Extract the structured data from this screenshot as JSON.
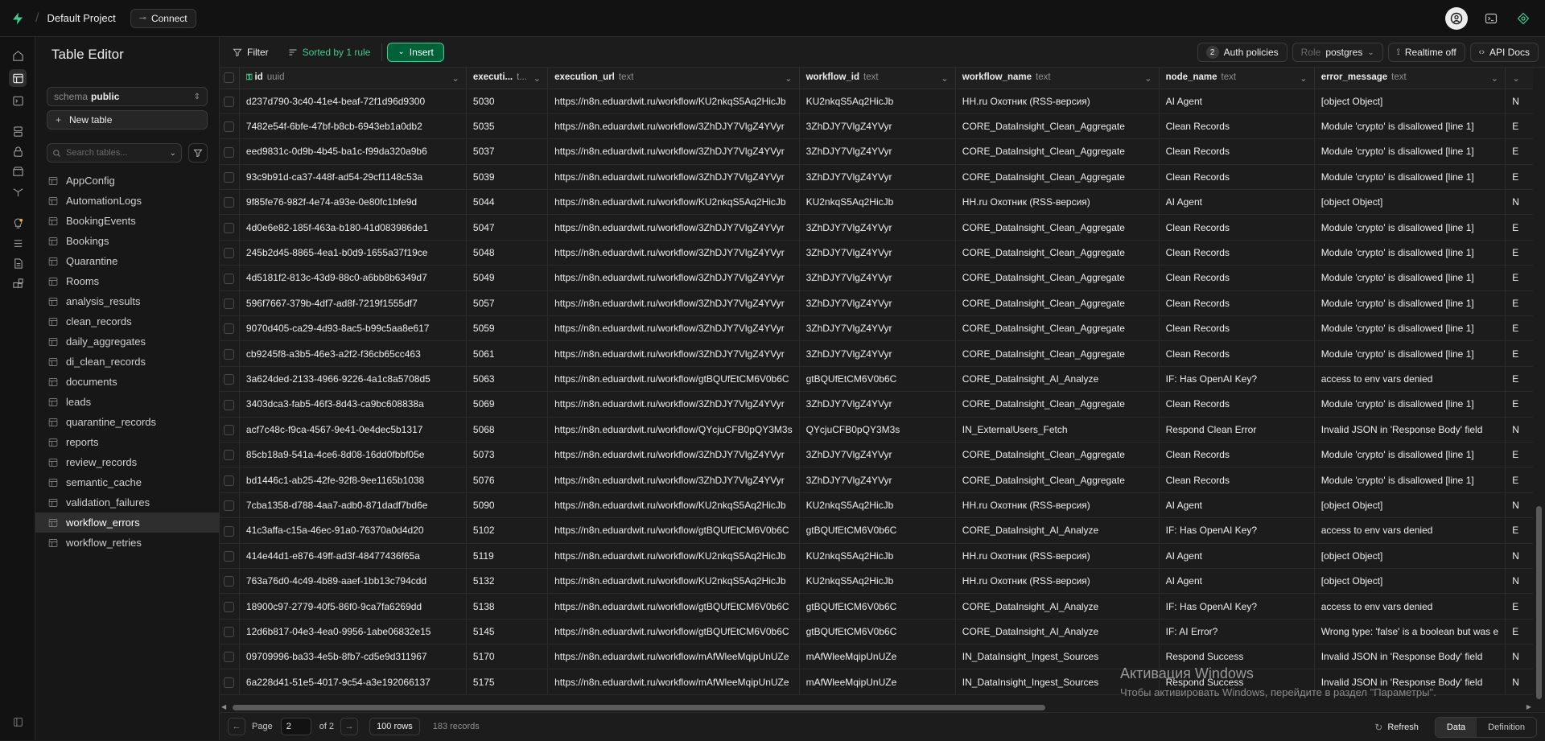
{
  "topbar": {
    "project": "Default Project",
    "connect": "Connect"
  },
  "sidebar": {
    "title": "Table Editor",
    "schema_label": "schema",
    "schema_value": "public",
    "new_table": "New table",
    "search_placeholder": "Search tables...",
    "tables": [
      "AppConfig",
      "AutomationLogs",
      "BookingEvents",
      "Bookings",
      "Quarantine",
      "Rooms",
      "analysis_results",
      "clean_records",
      "daily_aggregates",
      "di_clean_records",
      "documents",
      "leads",
      "quarantine_records",
      "reports",
      "review_records",
      "semantic_cache",
      "validation_failures",
      "workflow_errors",
      "workflow_retries"
    ],
    "active_table": "workflow_errors"
  },
  "toolbar": {
    "filter": "Filter",
    "sorted": "Sorted by 1 rule",
    "insert": "Insert",
    "auth_count": "2",
    "auth": "Auth policies",
    "role_label": "Role",
    "role_value": "postgres",
    "realtime": "Realtime off",
    "api_docs": "API Docs"
  },
  "columns": [
    {
      "name": "id",
      "type": "uuid"
    },
    {
      "name": "executi...",
      "type": "t..."
    },
    {
      "name": "execution_url",
      "type": "text"
    },
    {
      "name": "workflow_id",
      "type": "text"
    },
    {
      "name": "workflow_name",
      "type": "text"
    },
    {
      "name": "node_name",
      "type": "text"
    },
    {
      "name": "error_message",
      "type": "text"
    }
  ],
  "rows": [
    [
      "d237d790-3c40-41e4-beaf-72f1d96d9300",
      "5030",
      "https://n8n.eduardwit.ru/workflow/KU2nkqS5Aq2HicJb",
      "KU2nkqS5Aq2HicJb",
      "HH.ru Охотник (RSS-версия)",
      "AI Agent",
      "[object Object]",
      "N"
    ],
    [
      "7482e54f-6bfe-47bf-b8cb-6943eb1a0db2",
      "5035",
      "https://n8n.eduardwit.ru/workflow/3ZhDJY7VlgZ4YVyr",
      "3ZhDJY7VlgZ4YVyr",
      "CORE_DataInsight_Clean_Aggregate",
      "Clean Records",
      "Module 'crypto' is disallowed [line 1]",
      "E"
    ],
    [
      "eed9831c-0d9b-4b45-ba1c-f99da320a9b6",
      "5037",
      "https://n8n.eduardwit.ru/workflow/3ZhDJY7VlgZ4YVyr",
      "3ZhDJY7VlgZ4YVyr",
      "CORE_DataInsight_Clean_Aggregate",
      "Clean Records",
      "Module 'crypto' is disallowed [line 1]",
      "E"
    ],
    [
      "93c9b91d-ca37-448f-ad54-29cf1148c53a",
      "5039",
      "https://n8n.eduardwit.ru/workflow/3ZhDJY7VlgZ4YVyr",
      "3ZhDJY7VlgZ4YVyr",
      "CORE_DataInsight_Clean_Aggregate",
      "Clean Records",
      "Module 'crypto' is disallowed [line 1]",
      "E"
    ],
    [
      "9f85fe76-982f-4e74-a93e-0e80fc1bfe9d",
      "5044",
      "https://n8n.eduardwit.ru/workflow/KU2nkqS5Aq2HicJb",
      "KU2nkqS5Aq2HicJb",
      "HH.ru Охотник (RSS-версия)",
      "AI Agent",
      "[object Object]",
      "N"
    ],
    [
      "4d0e6e82-185f-463a-b180-41d083986de1",
      "5047",
      "https://n8n.eduardwit.ru/workflow/3ZhDJY7VlgZ4YVyr",
      "3ZhDJY7VlgZ4YVyr",
      "CORE_DataInsight_Clean_Aggregate",
      "Clean Records",
      "Module 'crypto' is disallowed [line 1]",
      "E"
    ],
    [
      "245b2d45-8865-4ea1-b0d9-1655a37f19ce",
      "5048",
      "https://n8n.eduardwit.ru/workflow/3ZhDJY7VlgZ4YVyr",
      "3ZhDJY7VlgZ4YVyr",
      "CORE_DataInsight_Clean_Aggregate",
      "Clean Records",
      "Module 'crypto' is disallowed [line 1]",
      "E"
    ],
    [
      "4d5181f2-813c-43d9-88c0-a6bb8b6349d7",
      "5049",
      "https://n8n.eduardwit.ru/workflow/3ZhDJY7VlgZ4YVyr",
      "3ZhDJY7VlgZ4YVyr",
      "CORE_DataInsight_Clean_Aggregate",
      "Clean Records",
      "Module 'crypto' is disallowed [line 1]",
      "E"
    ],
    [
      "596f7667-379b-4df7-ad8f-7219f1555df7",
      "5057",
      "https://n8n.eduardwit.ru/workflow/3ZhDJY7VlgZ4YVyr",
      "3ZhDJY7VlgZ4YVyr",
      "CORE_DataInsight_Clean_Aggregate",
      "Clean Records",
      "Module 'crypto' is disallowed [line 1]",
      "E"
    ],
    [
      "9070d405-ca29-4d93-8ac5-b99c5aa8e617",
      "5059",
      "https://n8n.eduardwit.ru/workflow/3ZhDJY7VlgZ4YVyr",
      "3ZhDJY7VlgZ4YVyr",
      "CORE_DataInsight_Clean_Aggregate",
      "Clean Records",
      "Module 'crypto' is disallowed [line 1]",
      "E"
    ],
    [
      "cb9245f8-a3b5-46e3-a2f2-f36cb65cc463",
      "5061",
      "https://n8n.eduardwit.ru/workflow/3ZhDJY7VlgZ4YVyr",
      "3ZhDJY7VlgZ4YVyr",
      "CORE_DataInsight_Clean_Aggregate",
      "Clean Records",
      "Module 'crypto' is disallowed [line 1]",
      "E"
    ],
    [
      "3a624ded-2133-4966-9226-4a1c8a5708d5",
      "5063",
      "https://n8n.eduardwit.ru/workflow/gtBQUfEtCM6V0b6C",
      "gtBQUfEtCM6V0b6C",
      "CORE_DataInsight_AI_Analyze",
      "IF: Has OpenAI Key?",
      "access to env vars denied",
      "E"
    ],
    [
      "3403dca3-fab5-46f3-8d43-ca9bc608838a",
      "5069",
      "https://n8n.eduardwit.ru/workflow/3ZhDJY7VlgZ4YVyr",
      "3ZhDJY7VlgZ4YVyr",
      "CORE_DataInsight_Clean_Aggregate",
      "Clean Records",
      "Module 'crypto' is disallowed [line 1]",
      "E"
    ],
    [
      "acf7c48c-f9ca-4567-9e41-0e4dec5b1317",
      "5068",
      "https://n8n.eduardwit.ru/workflow/QYcjuCFB0pQY3M3s",
      "QYcjuCFB0pQY3M3s",
      "IN_ExternalUsers_Fetch",
      "Respond Clean Error",
      "Invalid JSON in 'Response Body' field",
      "N"
    ],
    [
      "85cb18a9-541a-4ce6-8d08-16dd0fbbf05e",
      "5073",
      "https://n8n.eduardwit.ru/workflow/3ZhDJY7VlgZ4YVyr",
      "3ZhDJY7VlgZ4YVyr",
      "CORE_DataInsight_Clean_Aggregate",
      "Clean Records",
      "Module 'crypto' is disallowed [line 1]",
      "E"
    ],
    [
      "bd1446c1-ab25-42fe-92f8-9ee1165b1038",
      "5076",
      "https://n8n.eduardwit.ru/workflow/3ZhDJY7VlgZ4YVyr",
      "3ZhDJY7VlgZ4YVyr",
      "CORE_DataInsight_Clean_Aggregate",
      "Clean Records",
      "Module 'crypto' is disallowed [line 1]",
      "E"
    ],
    [
      "7cba1358-d788-4aa7-adb0-871dadf7bd6e",
      "5090",
      "https://n8n.eduardwit.ru/workflow/KU2nkqS5Aq2HicJb",
      "KU2nkqS5Aq2HicJb",
      "HH.ru Охотник (RSS-версия)",
      "AI Agent",
      "[object Object]",
      "N"
    ],
    [
      "41c3affa-c15a-46ec-91a0-76370a0d4d20",
      "5102",
      "https://n8n.eduardwit.ru/workflow/gtBQUfEtCM6V0b6C",
      "gtBQUfEtCM6V0b6C",
      "CORE_DataInsight_AI_Analyze",
      "IF: Has OpenAI Key?",
      "access to env vars denied",
      "E"
    ],
    [
      "414e44d1-e876-49ff-ad3f-48477436f65a",
      "5119",
      "https://n8n.eduardwit.ru/workflow/KU2nkqS5Aq2HicJb",
      "KU2nkqS5Aq2HicJb",
      "HH.ru Охотник (RSS-версия)",
      "AI Agent",
      "[object Object]",
      "N"
    ],
    [
      "763a76d0-4c49-4b89-aaef-1bb13c794cdd",
      "5132",
      "https://n8n.eduardwit.ru/workflow/KU2nkqS5Aq2HicJb",
      "KU2nkqS5Aq2HicJb",
      "HH.ru Охотник (RSS-версия)",
      "AI Agent",
      "[object Object]",
      "N"
    ],
    [
      "18900c97-2779-40f5-86f0-9ca7fa6269dd",
      "5138",
      "https://n8n.eduardwit.ru/workflow/gtBQUfEtCM6V0b6C",
      "gtBQUfEtCM6V0b6C",
      "CORE_DataInsight_AI_Analyze",
      "IF: Has OpenAI Key?",
      "access to env vars denied",
      "E"
    ],
    [
      "12d6b817-04e3-4ea0-9956-1abe06832e15",
      "5145",
      "https://n8n.eduardwit.ru/workflow/gtBQUfEtCM6V0b6C",
      "gtBQUfEtCM6V0b6C",
      "CORE_DataInsight_AI_Analyze",
      "IF: AI Error?",
      "Wrong type: 'false' is a boolean but was e",
      "E"
    ],
    [
      "09709996-ba33-4e5b-8fb7-cd5e9d311967",
      "5170",
      "https://n8n.eduardwit.ru/workflow/mAfWleeMqipUnUZe",
      "mAfWleeMqipUnUZe",
      "IN_DataInsight_Ingest_Sources",
      "Respond Success",
      "Invalid JSON in 'Response Body' field",
      "N"
    ],
    [
      "6a228d41-51e5-4017-9c54-a3e192066137",
      "5175",
      "https://n8n.eduardwit.ru/workflow/mAfWleeMqipUnUZe",
      "mAfWleeMqipUnUZe",
      "IN_DataInsight_Ingest_Sources",
      "Respond Success",
      "Invalid JSON in 'Response Body' field",
      "N"
    ]
  ],
  "footer": {
    "page_label": "Page",
    "page_value": "2",
    "of_label": "of 2",
    "rows": "100 rows",
    "records": "183 records",
    "refresh": "Refresh",
    "data_tab": "Data",
    "definition_tab": "Definition"
  },
  "watermark": {
    "title": "Активация Windows",
    "subtitle": "Чтобы активировать Windows, перейдите в раздел \"Параметры\"."
  },
  "colors": {
    "accent": "#3ecf8e",
    "bg": "#1c1c1c",
    "sidebar": "#171717"
  }
}
